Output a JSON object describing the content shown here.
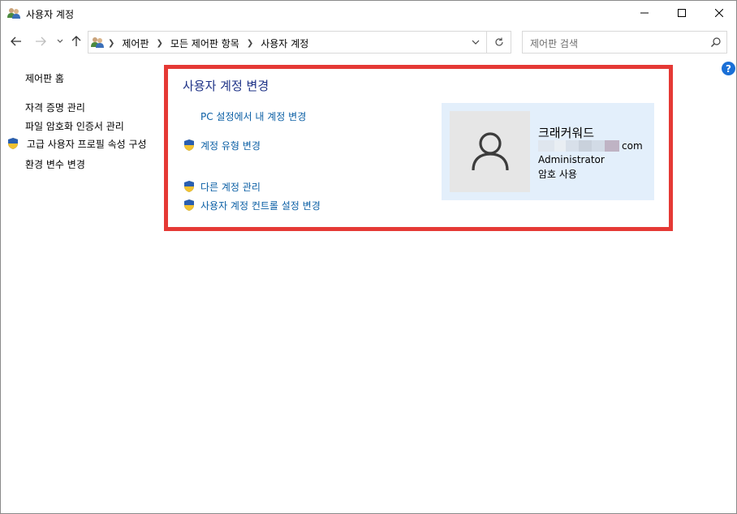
{
  "window": {
    "title": "사용자 계정"
  },
  "address": {
    "breadcrumbs": [
      "제어판",
      "모든 제어판 항목",
      "사용자 계정"
    ]
  },
  "search": {
    "placeholder": "제어판 검색"
  },
  "help": {
    "label": "?"
  },
  "leftnav": {
    "items": [
      {
        "label": "제어판 홈",
        "shield": false
      },
      {
        "label": "자격 증명 관리",
        "shield": false
      },
      {
        "label": "파일 암호화 인증서 관리",
        "shield": false
      },
      {
        "label": "고급 사용자 프로필 속성 구성",
        "shield": true
      },
      {
        "label": "환경 변수 변경",
        "shield": false
      }
    ]
  },
  "main": {
    "title": "사용자 계정 변경",
    "links": [
      {
        "label": "PC 설정에서 내 계정 변경",
        "shield": false
      },
      {
        "label": "계정 유형 변경",
        "shield": true
      },
      {
        "label": "다른 계정 관리",
        "shield": true
      },
      {
        "label": "사용자 계정 컨트롤 설정 변경",
        "shield": true
      }
    ]
  },
  "user": {
    "name": "크래커워드",
    "email_suffix": "com",
    "role": "Administrator",
    "password_status": "암호 사용"
  },
  "colors": {
    "highlight_border": "#e53935",
    "link": "#0b5fa5",
    "heading": "#1e3287",
    "user_panel_bg": "#e3effb"
  }
}
